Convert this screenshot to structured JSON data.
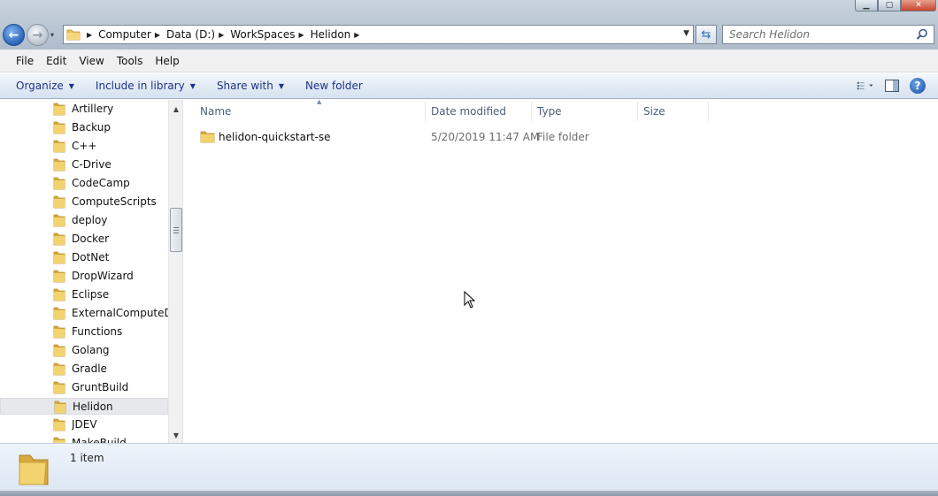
{
  "window": {
    "minimize_glyph": "▁",
    "maximize_glyph": "▢",
    "close_glyph": "✕"
  },
  "nav": {
    "back_glyph": "←",
    "forward_glyph": "→",
    "history_glyph": "▾"
  },
  "address": {
    "breadcrumbs": [
      "Computer",
      "Data (D:)",
      "WorkSpaces",
      "Helidon"
    ],
    "separator_glyph": "▶",
    "dropdown_glyph": "▼",
    "refresh_glyph": "⇆"
  },
  "search": {
    "placeholder": "Search Helidon"
  },
  "menu": {
    "items": [
      "File",
      "Edit",
      "View",
      "Tools",
      "Help"
    ]
  },
  "toolbar": {
    "organize": "Organize",
    "include_in_library": "Include in library",
    "share_with": "Share with",
    "new_folder": "New folder",
    "caret": "▼",
    "help": "?"
  },
  "tree": {
    "items": [
      "Artillery",
      "Backup",
      "C++",
      "C-Drive",
      "CodeCamp",
      "ComputeScripts",
      "deploy",
      "Docker",
      "DotNet",
      "DropWizard",
      "Eclipse",
      "ExternalComputeDem",
      "Functions",
      "Golang",
      "Gradle",
      "GruntBuild",
      "Helidon",
      "JDEV",
      "MakeBuild"
    ],
    "selected": "Helidon",
    "scroll_up_glyph": "▲",
    "scroll_down_glyph": "▼"
  },
  "columns": {
    "name": "Name",
    "date_modified": "Date modified",
    "type": "Type",
    "size": "Size",
    "sort_glyph": "▲"
  },
  "files": [
    {
      "name": "helidon-quickstart-se",
      "date_modified": "5/20/2019 11:47 AM",
      "type": "File folder",
      "size": ""
    }
  ],
  "status": {
    "item_count": "1 item"
  },
  "colors": {
    "folder": "#e8c25a",
    "command_text": "#1e3287",
    "selection": "#e6e8ec"
  }
}
